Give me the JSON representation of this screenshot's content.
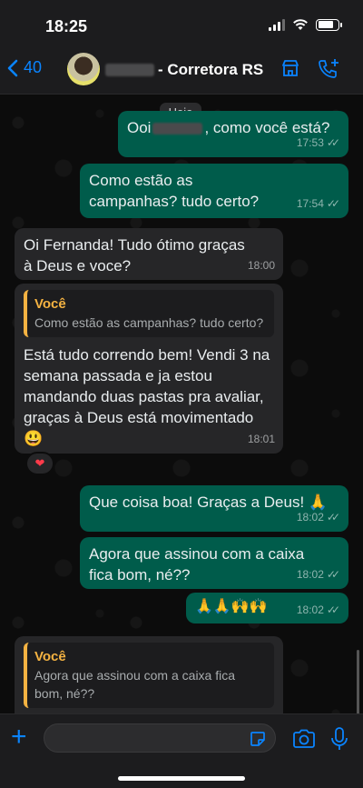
{
  "status": {
    "time": "18:25"
  },
  "header": {
    "back_count": "40",
    "contact_name_suffix": "- Corretora RS"
  },
  "chat": {
    "day_label": "Hoje",
    "messages": [
      {
        "pre": "Ooi",
        "post": ", como você está?",
        "time": "17:53"
      },
      {
        "text": "Como estão as campanhas? tudo certo?",
        "time": "17:54"
      },
      {
        "text": "Oi Fernanda! Tudo ótimo graças à Deus e voce?",
        "time": "18:00"
      },
      {
        "quote_author": "Você",
        "quote_text": "Como estão as campanhas? tudo certo?",
        "text": "Está tudo correndo bem! Vendi 3 na semana passada e ja estou mandando duas pastas pra avaliar, graças à Deus está movimentado 😃",
        "time": "18:01",
        "reaction": "❤"
      },
      {
        "text": "Que coisa boa! Graças a Deus! 🙏",
        "time": "18:02"
      },
      {
        "text": "Agora que assinou com a caixa fica bom, né??",
        "time": "18:02"
      },
      {
        "text": "🙏🙏🙌🙌",
        "time": "18:02"
      },
      {
        "quote_author": "Você",
        "quote_text": "Agora que assinou com a caixa fica bom, né??"
      }
    ]
  },
  "composer": {
    "placeholder": ""
  }
}
